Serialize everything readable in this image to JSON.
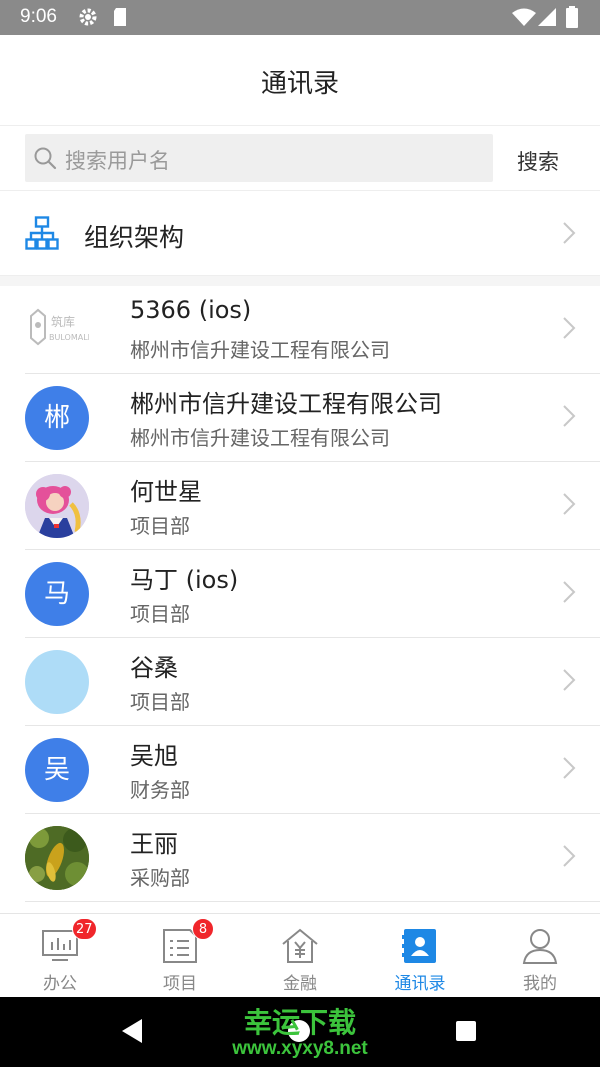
{
  "status_bar": {
    "time": "9:06",
    "icons": [
      "gear-icon",
      "sd-card-icon",
      "wifi-icon",
      "signal-icon",
      "battery-icon"
    ]
  },
  "header": {
    "title": "通讯录"
  },
  "search": {
    "placeholder": "搜索用户名",
    "button_label": "搜索"
  },
  "org": {
    "label": "组织架构",
    "icon": "org-chart-icon"
  },
  "contacts": [
    {
      "name": "5366 (ios)",
      "company": "郴州市信升建设工程有限公司",
      "avatar_type": "logo",
      "avatar_logo_text": "筑库 BULOMALL"
    },
    {
      "name": "郴州市信升建设工程有限公司",
      "company": "郴州市信升建设工程有限公司",
      "avatar_type": "initial",
      "avatar_initial": "郴",
      "avatar_color": "#3f7fe8"
    },
    {
      "name": "何世星",
      "company": "项目部",
      "avatar_type": "photo",
      "avatar_desc": "cartoon-girl"
    },
    {
      "name": "马丁 (ios)",
      "company": "项目部",
      "avatar_type": "initial",
      "avatar_initial": "马",
      "avatar_color": "#3f7fe8"
    },
    {
      "name": "谷桑",
      "company": "项目部",
      "avatar_type": "blank",
      "avatar_color": "#aedcf7"
    },
    {
      "name": "吴旭",
      "company": "财务部",
      "avatar_type": "initial",
      "avatar_initial": "吴",
      "avatar_color": "#3f7fe8"
    },
    {
      "name": "王丽",
      "company": "采购部",
      "avatar_type": "photo",
      "avatar_desc": "plant"
    }
  ],
  "tabs": [
    {
      "label": "办公",
      "icon": "dashboard-icon",
      "badge": "27",
      "active": false
    },
    {
      "label": "项目",
      "icon": "document-list-icon",
      "badge": "8",
      "active": false
    },
    {
      "label": "金融",
      "icon": "finance-house-icon",
      "badge": "",
      "active": false
    },
    {
      "label": "通讯录",
      "icon": "contacts-book-icon",
      "badge": "",
      "active": true
    },
    {
      "label": "我的",
      "icon": "person-icon",
      "badge": "",
      "active": false
    }
  ],
  "watermark": {
    "line1": "幸运下载",
    "line2": "www.xyxy8.net"
  },
  "colors": {
    "accent": "#1e88e5",
    "badge": "#f0262b",
    "initial_avatar": "#3f7fe8"
  }
}
